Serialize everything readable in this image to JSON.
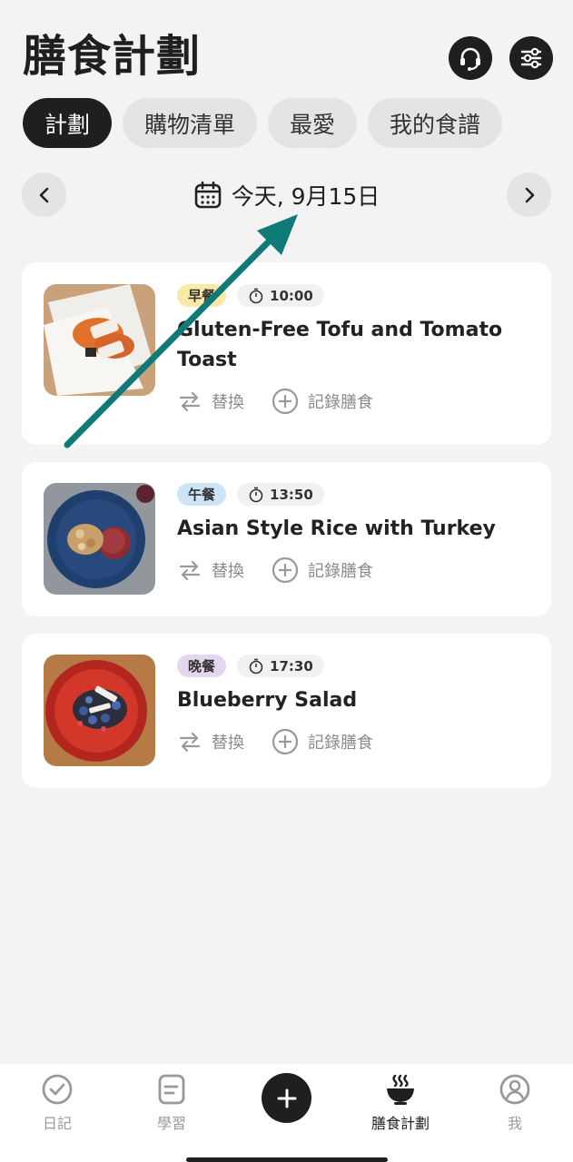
{
  "header": {
    "title": "膳食計劃",
    "support_icon": "headset-icon",
    "settings_icon": "sliders-icon"
  },
  "tabs": [
    {
      "label": "計劃",
      "active": true
    },
    {
      "label": "購物清單",
      "active": false
    },
    {
      "label": "最愛",
      "active": false
    },
    {
      "label": "我的食譜",
      "active": false
    }
  ],
  "date": {
    "label": "今天, 9月15日",
    "icon": "calendar-icon"
  },
  "meals": [
    {
      "type": "早餐",
      "time": "10:00",
      "title": "Gluten-Free Tofu and Tomato Toast",
      "badge_color": "#fbe9a6",
      "swap_label": "替換",
      "log_label": "記錄膳食"
    },
    {
      "type": "午餐",
      "time": "13:50",
      "title": "Asian Style Rice with Turkey",
      "badge_color": "#cde4f7",
      "swap_label": "替換",
      "log_label": "記錄膳食"
    },
    {
      "type": "晚餐",
      "time": "17:30",
      "title": "Blueberry Salad",
      "badge_color": "#e5d6f0",
      "swap_label": "替換",
      "log_label": "記錄膳食"
    }
  ],
  "bottom_nav": [
    {
      "label": "日記",
      "icon": "check-circle-icon"
    },
    {
      "label": "學習",
      "icon": "notes-icon"
    },
    {
      "label": "",
      "icon": "plus-icon"
    },
    {
      "label": "膳食計劃",
      "icon": "bowl-icon",
      "active": true
    },
    {
      "label": "我",
      "icon": "profile-icon"
    }
  ],
  "colors": {
    "accent": "#1f1f1f",
    "annotation_arrow": "#0f7a78"
  }
}
